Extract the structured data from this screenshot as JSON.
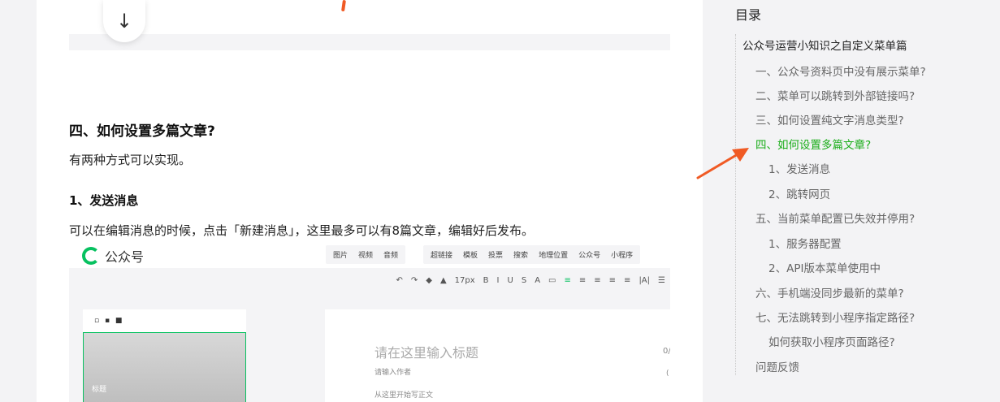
{
  "article": {
    "heading_4": "四、如何设置多篇文章?",
    "intro": "有两种方式可以实现。",
    "sub_heading_1": "1、发送消息",
    "sub_paragraph_1": "可以在编辑消息的时候，点击「新建消息」，这里最多可以有8篇文章，编辑好后发布。"
  },
  "editor": {
    "brand": "公众号",
    "tools_a": [
      "图片",
      "视频",
      "音频"
    ],
    "tools_b": [
      "超链接",
      "模板",
      "投票",
      "搜索",
      "地理位置",
      "公众号",
      "小程序"
    ],
    "format_bar": [
      "↶",
      "↷",
      "◆",
      "▲",
      "17px",
      "B",
      "I",
      "U",
      "S",
      "A",
      "▭",
      "≡",
      "≡",
      "≡",
      "≡",
      "≡",
      "|A|",
      "☰"
    ],
    "cover_label": "标题",
    "title_placeholder": "请在这里输入标题",
    "author_placeholder": "请输入作者",
    "body_placeholder": "从这里开始写正文",
    "title_counter": "0/",
    "author_counter": "("
  },
  "toc": {
    "title": "目录",
    "items": [
      {
        "label": "公众号运营小知识之自定义菜单篇",
        "level": 0
      },
      {
        "label": "一、公众号资料页中没有展示菜单?",
        "level": 1
      },
      {
        "label": "二、菜单可以跳转到外部链接吗?",
        "level": 1
      },
      {
        "label": "三、如何设置纯文字消息类型?",
        "level": 1
      },
      {
        "label": "四、如何设置多篇文章?",
        "level": 1,
        "active": true
      },
      {
        "label": "1、发送消息",
        "level": 2
      },
      {
        "label": "2、跳转网页",
        "level": 2
      },
      {
        "label": "五、当前菜单配置已失效并停用?",
        "level": 1
      },
      {
        "label": "1、服务器配置",
        "level": 2
      },
      {
        "label": "2、API版本菜单使用中",
        "level": 2
      },
      {
        "label": "六、手机端没同步最新的菜单?",
        "level": 1
      },
      {
        "label": "七、无法跳转到小程序指定路径?",
        "level": 1
      },
      {
        "label": "如何获取小程序页面路径?",
        "level": 2
      },
      {
        "label": "问题反馈",
        "level": 1
      }
    ]
  },
  "colors": {
    "accent": "#1aad19",
    "annotation_arrow": "#f05a24"
  },
  "icons": {
    "scroll_down": "arrow-down-icon"
  }
}
